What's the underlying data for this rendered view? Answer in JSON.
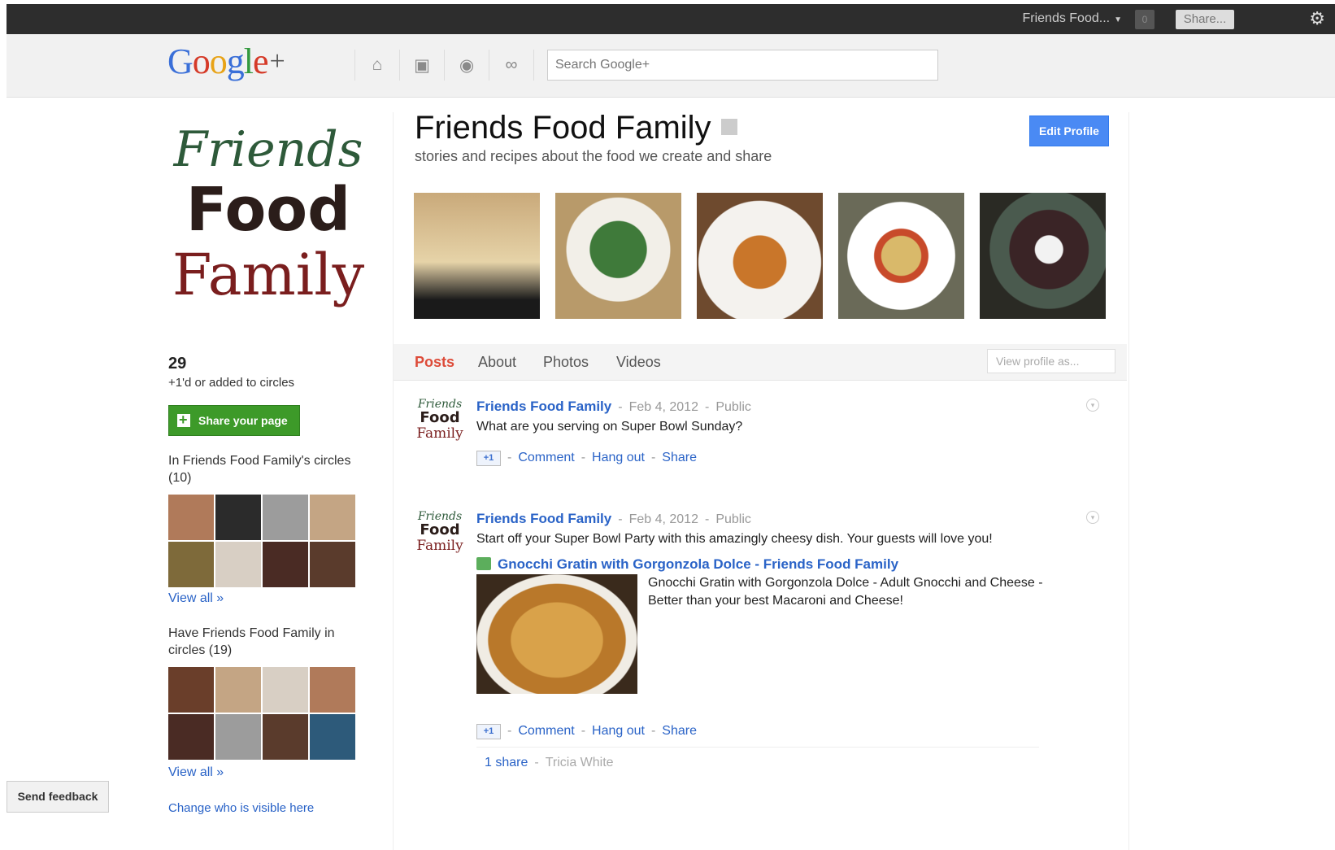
{
  "topbar": {
    "account_name": "Friends Food...",
    "notifications": "0",
    "share_label": "Share..."
  },
  "header": {
    "logo_text": "Google",
    "logo_plus": "+",
    "search_placeholder": "Search Google+"
  },
  "sidebar": {
    "brand_line1": "Friends",
    "brand_line2": "Food",
    "brand_line3": "Family",
    "count": "29",
    "count_label": "+1'd or added to circles",
    "share_page_label": "Share your page",
    "in_circles_heading": "In Friends Food Family's circles (10)",
    "in_circles_view_all": "View all »",
    "have_in_circles_heading": "Have Friends Food Family in circles (19)",
    "have_in_circles_view_all": "View all »",
    "change_visible": "Change who is visible here",
    "send_feedback": "Send feedback"
  },
  "profile": {
    "name": "Friends Food Family",
    "tagline": "stories and recipes about the food we create and share",
    "edit_profile": "Edit Profile"
  },
  "tabs": [
    "Posts",
    "About",
    "Photos",
    "Videos"
  ],
  "view_profile_as": "View profile as...",
  "posts": [
    {
      "author": "Friends Food Family",
      "date": "Feb 4, 2012",
      "visibility": "Public",
      "text": "What are you serving on Super Bowl Sunday?",
      "plusone": "+1",
      "comment": "Comment",
      "hangout": "Hang out",
      "share": "Share"
    },
    {
      "author": "Friends Food Family",
      "date": "Feb 4, 2012",
      "visibility": "Public",
      "text": "Start off your Super Bowl Party with this amazingly cheesy dish. Your guests will love you!",
      "link_title": "Gnocchi Gratin with Gorgonzola Dolce - Friends Food Family",
      "link_desc": "Gnocchi Gratin with Gorgonzola Dolce - Adult Gnocchi and Cheese - Better than your best Macaroni and Cheese!",
      "plusone": "+1",
      "comment": "Comment",
      "hangout": "Hang out",
      "share": "Share",
      "shares_count": "1 share",
      "shared_by": "Tricia White"
    }
  ],
  "colors": {
    "accent_red": "#dd4b39",
    "link_blue": "#2a63c7",
    "green_button": "#3d9a29",
    "edit_blue": "#4a8af4"
  }
}
